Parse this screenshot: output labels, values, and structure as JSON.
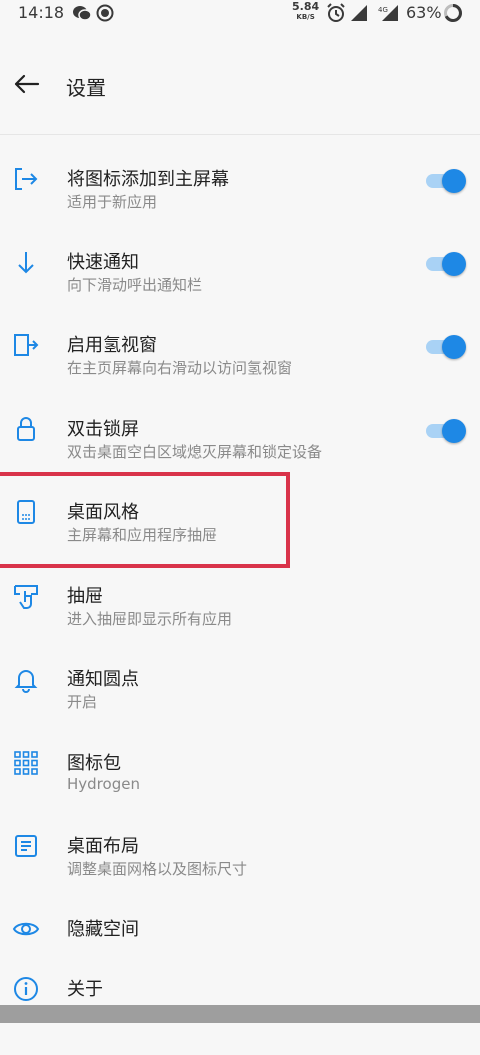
{
  "status": {
    "time": "14:18",
    "speed_value": "5.84",
    "speed_unit": "KB/S",
    "signal_tag": "4G",
    "battery": "63%"
  },
  "header": {
    "title": "设置"
  },
  "colors": {
    "accent": "#1e88e5",
    "highlight": "#d9334a"
  },
  "items": [
    {
      "icon": "add-to-home-icon",
      "label": "将图标添加到主屏幕",
      "sub": "适用于新应用",
      "toggle": true
    },
    {
      "icon": "arrow-down-icon",
      "label": "快速通知",
      "sub": "向下滑动呼出通知栏",
      "toggle": true
    },
    {
      "icon": "shelf-icon",
      "label": "启用氢视窗",
      "sub": "在主页屏幕向右滑动以访问氢视窗",
      "toggle": true
    },
    {
      "icon": "lock-icon",
      "label": "双击锁屏",
      "sub": "双击桌面空白区域熄灭屏幕和锁定设备",
      "toggle": true
    },
    {
      "icon": "phone-layout-icon",
      "label": "桌面风格",
      "sub": "主屏幕和应用程序抽屉"
    },
    {
      "icon": "drawer-swipe-icon",
      "label": "抽屉",
      "sub": "进入抽屉即显示所有应用"
    },
    {
      "icon": "bell-icon",
      "label": "通知圆点",
      "sub": "开启"
    },
    {
      "icon": "grid-icon",
      "label": "图标包",
      "sub": "Hydrogen"
    },
    {
      "icon": "layout-icon",
      "label": "桌面布局",
      "sub": "调整桌面网格以及图标尺寸"
    },
    {
      "icon": "eye-icon",
      "label": "隐藏空间",
      "sub": ""
    },
    {
      "icon": "info-icon",
      "label": "关于",
      "sub": ""
    }
  ]
}
